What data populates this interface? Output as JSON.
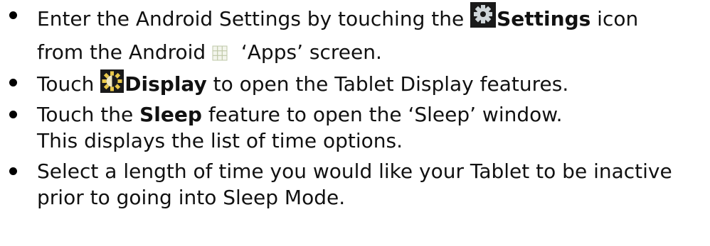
{
  "steps": [
    {
      "lines": [
        {
          "before": "Enter the Android Settings by touching the ",
          "icon": "settings-gear-icon",
          "bold": "Settings",
          "after": " icon"
        },
        {
          "before": "from the Android ",
          "icon": "apps-grid-icon",
          "after": "  ‘Apps’ screen."
        }
      ]
    },
    {
      "lines": [
        {
          "before": "Touch ",
          "icon": "display-brightness-icon",
          "bold": "Display",
          "after": " to open the Tablet Display features."
        }
      ]
    },
    {
      "lines": [
        {
          "before": "Touch the ",
          "bold": "Sleep",
          "after": " feature to open the ‘Sleep’ window."
        },
        {
          "text": "This displays the list of time options."
        }
      ]
    },
    {
      "lines": [
        {
          "text": "Select a length of time you would like your Tablet to be inactive"
        },
        {
          "text": "prior to going into Sleep Mode."
        }
      ]
    }
  ],
  "colors": {
    "text": "#111111",
    "icon_dark": "#1a1a1a",
    "icon_gear": "#cfd6d9",
    "icon_sun": "#e9c94a",
    "grid_line": "#bfc8a8"
  }
}
